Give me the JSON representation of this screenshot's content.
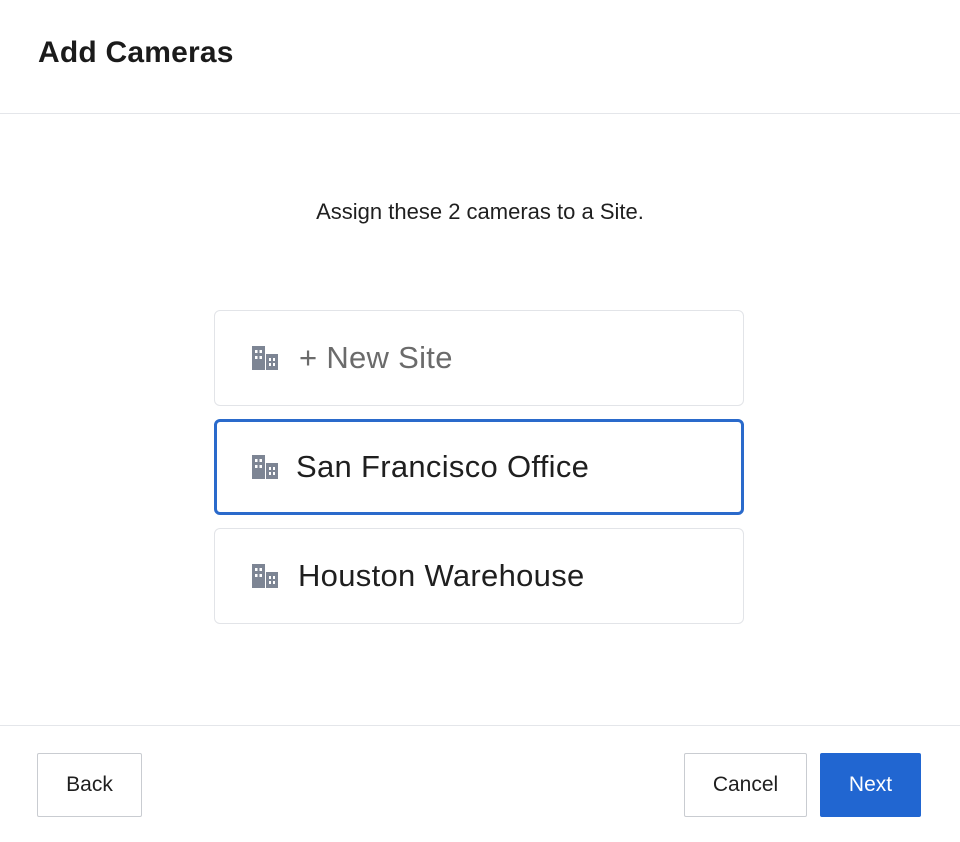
{
  "header": {
    "title": "Add Cameras"
  },
  "body": {
    "instruction": "Assign these 2 cameras to a Site."
  },
  "sites": [
    {
      "label": "+ New Site",
      "icon": "building-icon",
      "selected": false
    },
    {
      "label": "San Francisco Office",
      "icon": "building-icon",
      "selected": true
    },
    {
      "label": "Houston Warehouse",
      "icon": "building-icon",
      "selected": false
    }
  ],
  "footer": {
    "back_label": "Back",
    "cancel_label": "Cancel",
    "next_label": "Next"
  },
  "colors": {
    "accent": "#2166d1",
    "selected_border": "#2a6acb",
    "icon": "#7d8594"
  }
}
